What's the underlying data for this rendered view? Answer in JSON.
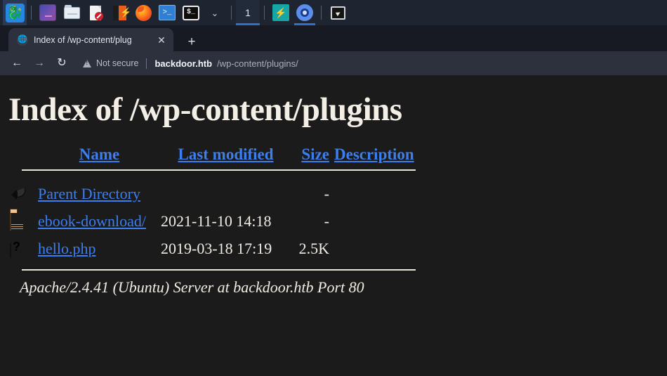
{
  "taskbar": {
    "items": [
      {
        "name": "kali-menu",
        "icon": "kali-dragon-icon",
        "label": ""
      },
      {
        "name": "app-window",
        "icon": "window-thumb-icon",
        "label": ""
      },
      {
        "name": "file-manager",
        "icon": "folder-icon",
        "label": ""
      },
      {
        "name": "document-viewer",
        "icon": "document-deny-icon",
        "label": ""
      },
      {
        "name": "burp-suite",
        "icon": "burp-suite-icon",
        "label": ""
      },
      {
        "name": "firefox",
        "icon": "firefox-icon",
        "label": ""
      },
      {
        "name": "powershell",
        "icon": "powershell-icon",
        "label": ">_"
      },
      {
        "name": "terminal",
        "icon": "terminal-icon",
        "label": "$_"
      },
      {
        "name": "show-more",
        "icon": "chevron-down-icon",
        "label": "⌄"
      }
    ],
    "workspace": "1",
    "tray": [
      {
        "name": "tray-app-teal",
        "icon": "lightning-bolt-icon",
        "label": "⚡"
      },
      {
        "name": "tray-chromium",
        "icon": "chromium-icon",
        "label": ""
      },
      {
        "name": "tray-terminal",
        "icon": "terminal-small-icon",
        "label": ""
      }
    ]
  },
  "browser": {
    "tab": {
      "favicon": "globe-icon",
      "title": "Index of /wp-content/plug",
      "close_label": "✕"
    },
    "new_tab_label": "+",
    "nav": {
      "back_label": "←",
      "forward_label": "→",
      "reload_label": "↻"
    },
    "address": {
      "security_label": "Not secure",
      "host": "backdoor.htb",
      "path": "/wp-content/plugins/"
    }
  },
  "page": {
    "heading": "Index of /wp-content/plugins",
    "columns": [
      {
        "key": "name",
        "label": "Name"
      },
      {
        "key": "modified",
        "label": "Last modified"
      },
      {
        "key": "size",
        "label": "Size"
      },
      {
        "key": "description",
        "label": "Description"
      }
    ],
    "entries": [
      {
        "icon": "parent-directory-icon",
        "name": "Parent Directory",
        "modified": "",
        "size": "-",
        "description": ""
      },
      {
        "icon": "folder-icon",
        "name": "ebook-download/",
        "modified": "2021-11-10 14:18",
        "size": "-",
        "description": ""
      },
      {
        "icon": "unknown-file-icon",
        "name": "hello.php",
        "modified": "2019-03-18 17:19",
        "size": "2.5K",
        "description": ""
      }
    ],
    "footer": "Apache/2.4.41 (Ubuntu) Server at backdoor.htb Port 80"
  },
  "colors": {
    "page_background": "#1b1b1b",
    "link": "#3b7ef0",
    "text": "#f1ece3",
    "toolbar": "#2c313d",
    "tabstrip": "#171a22",
    "taskbar": "#1e2430",
    "accent": "#2f6fd0"
  }
}
